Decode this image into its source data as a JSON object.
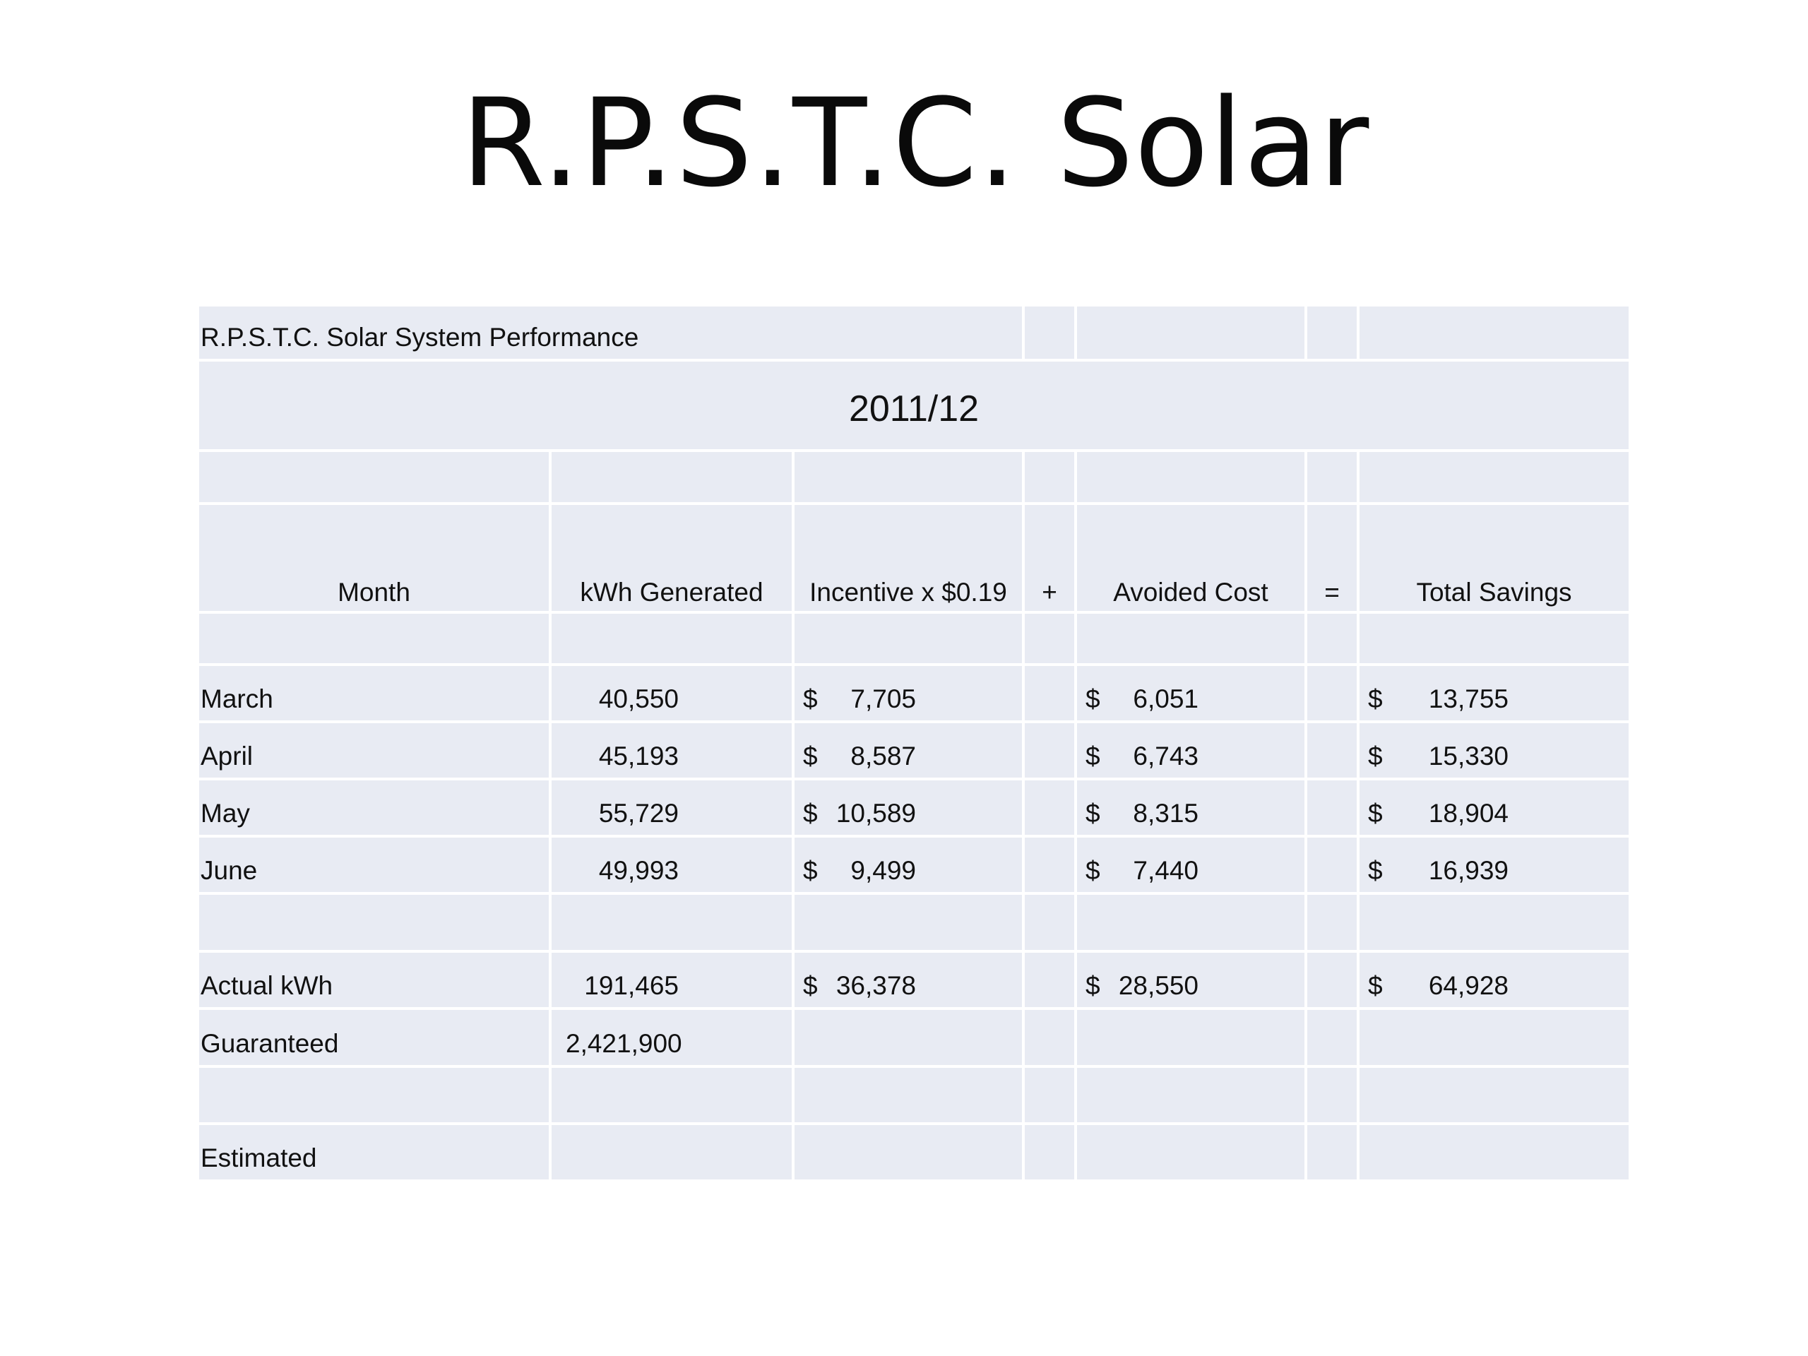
{
  "slide": {
    "title": "R.P.S.T.C. Solar"
  },
  "table": {
    "caption": "R.P.S.T.C. Solar System Performance",
    "period": "2011/12",
    "headers": {
      "month": "Month",
      "kwh": "kWh Generated",
      "incentive": "Incentive x $0.19",
      "plus": "+",
      "avoided": "Avoided Cost",
      "equals": "=",
      "total": "Total Savings"
    },
    "currency_symbol": "$",
    "rows": [
      {
        "month": "March",
        "kwh": "40,550",
        "incentive": "7,705",
        "avoided": "6,051",
        "total": "13,755"
      },
      {
        "month": "April",
        "kwh": "45,193",
        "incentive": "8,587",
        "avoided": "6,743",
        "total": "15,330"
      },
      {
        "month": "May",
        "kwh": "55,729",
        "incentive": "10,589",
        "avoided": "8,315",
        "total": "18,904"
      },
      {
        "month": "June",
        "kwh": "49,993",
        "incentive": "9,499",
        "avoided": "7,440",
        "total": "16,939"
      }
    ],
    "actual": {
      "label": "Actual kWh",
      "kwh": "191,465",
      "incentive": "36,378",
      "avoided": "28,550",
      "total": "64,928"
    },
    "guaranteed": {
      "label": "Guaranteed",
      "kwh": "2,421,900"
    },
    "estimated": {
      "label": "Estimated"
    }
  }
}
